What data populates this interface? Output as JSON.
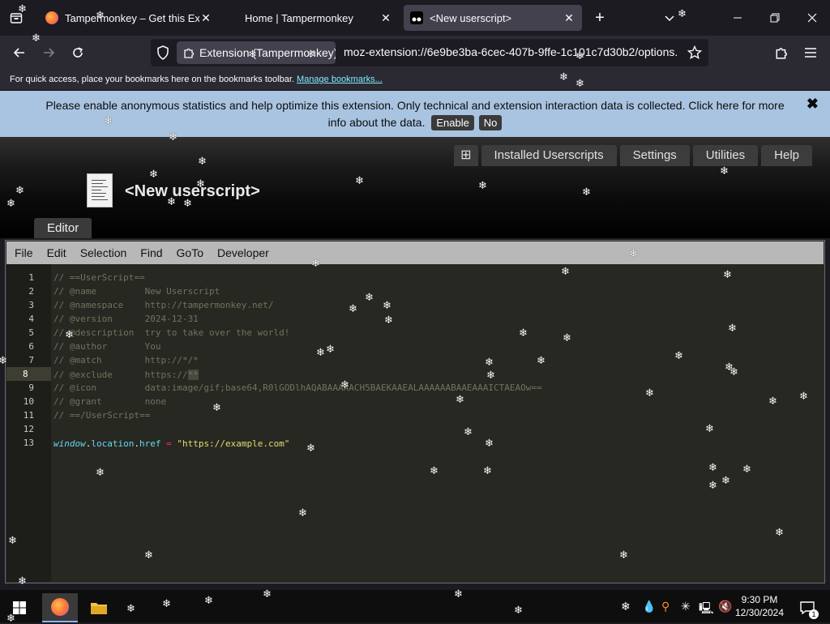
{
  "browser": {
    "tabs": [
      {
        "title": "Tampermonkey – Get this Exter",
        "active": false
      },
      {
        "title": "Home | Tampermonkey",
        "active": false
      },
      {
        "title": "<New userscript>",
        "active": true
      }
    ],
    "new_tab_label": "+",
    "extension_chip": "Extension (Tampermonkey)",
    "url": "moz-extension://6e9be3ba-6cec-407b-9ffe-1c101c7d30b2/options.",
    "bookmarks_text": "For quick access, place your bookmarks here on the bookmarks toolbar.",
    "bookmarks_link": "Manage bookmarks..."
  },
  "banner": {
    "text": "Please enable anonymous statistics and help optimize this extension. Only technical and extension interaction data is collected. Click here for more info about the data.",
    "enable_label": "Enable",
    "no_label": "No",
    "close_label": "✖"
  },
  "tampermonkey": {
    "plus_label": "⊞",
    "tabs": [
      "Installed Userscripts",
      "Settings",
      "Utilities",
      "Help"
    ],
    "page_title": "<New userscript>",
    "editor_tab": "Editor",
    "menu": [
      "File",
      "Edit",
      "Selection",
      "Find",
      "GoTo",
      "Developer"
    ]
  },
  "editor": {
    "current_line": 8,
    "lines": [
      "// ==UserScript==",
      "// @name         New Userscript",
      "// @namespace    http://tampermonkey.net/",
      "// @version      2024-12-31",
      "// @description  try to take over the world!",
      "// @author       You",
      "// @match        http://*/*",
      "// @exclude      https://",
      "// @icon         data:image/gif;base64,R0lGODlhAQABAAAAACH5BAEKAAEALAAAAAABAAEAAAICTAEAOw==",
      "// @grant        none",
      "// ==/UserScript==",
      "",
      ""
    ],
    "line13": {
      "obj": "window",
      "dot1": ".",
      "prop1": "location",
      "dot2": ".",
      "prop2": "href",
      "op": " = ",
      "str": "\"https://example.com\""
    },
    "selected_text": "**"
  },
  "taskbar": {
    "time": "9:30 PM",
    "date": "12/30/2024",
    "notification_count": "1"
  }
}
